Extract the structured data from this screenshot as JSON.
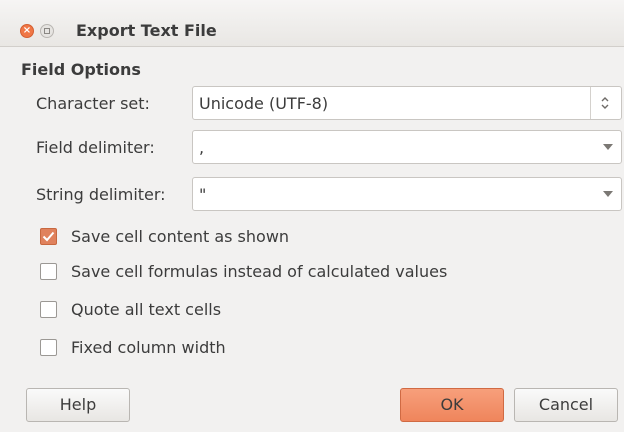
{
  "window": {
    "title": "Export Text File"
  },
  "field_options": {
    "heading": "Field Options",
    "character_set": {
      "label": "Character set:",
      "value": "Unicode (UTF-8)"
    },
    "field_delimiter": {
      "label": "Field delimiter:",
      "value": ","
    },
    "string_delimiter": {
      "label": "String delimiter:",
      "value": "\""
    }
  },
  "checkboxes": [
    {
      "label": "Save cell content as shown",
      "checked": true
    },
    {
      "label": "Save cell formulas instead of calculated values",
      "checked": false
    },
    {
      "label": "Quote all text cells",
      "checked": false
    },
    {
      "label": "Fixed column width",
      "checked": false
    }
  ],
  "buttons": {
    "help": "Help",
    "ok": "OK",
    "cancel": "Cancel"
  },
  "colors": {
    "accent": "#ef855c",
    "checkbox_checked": "#e0825d",
    "close_button": "#f07746"
  }
}
